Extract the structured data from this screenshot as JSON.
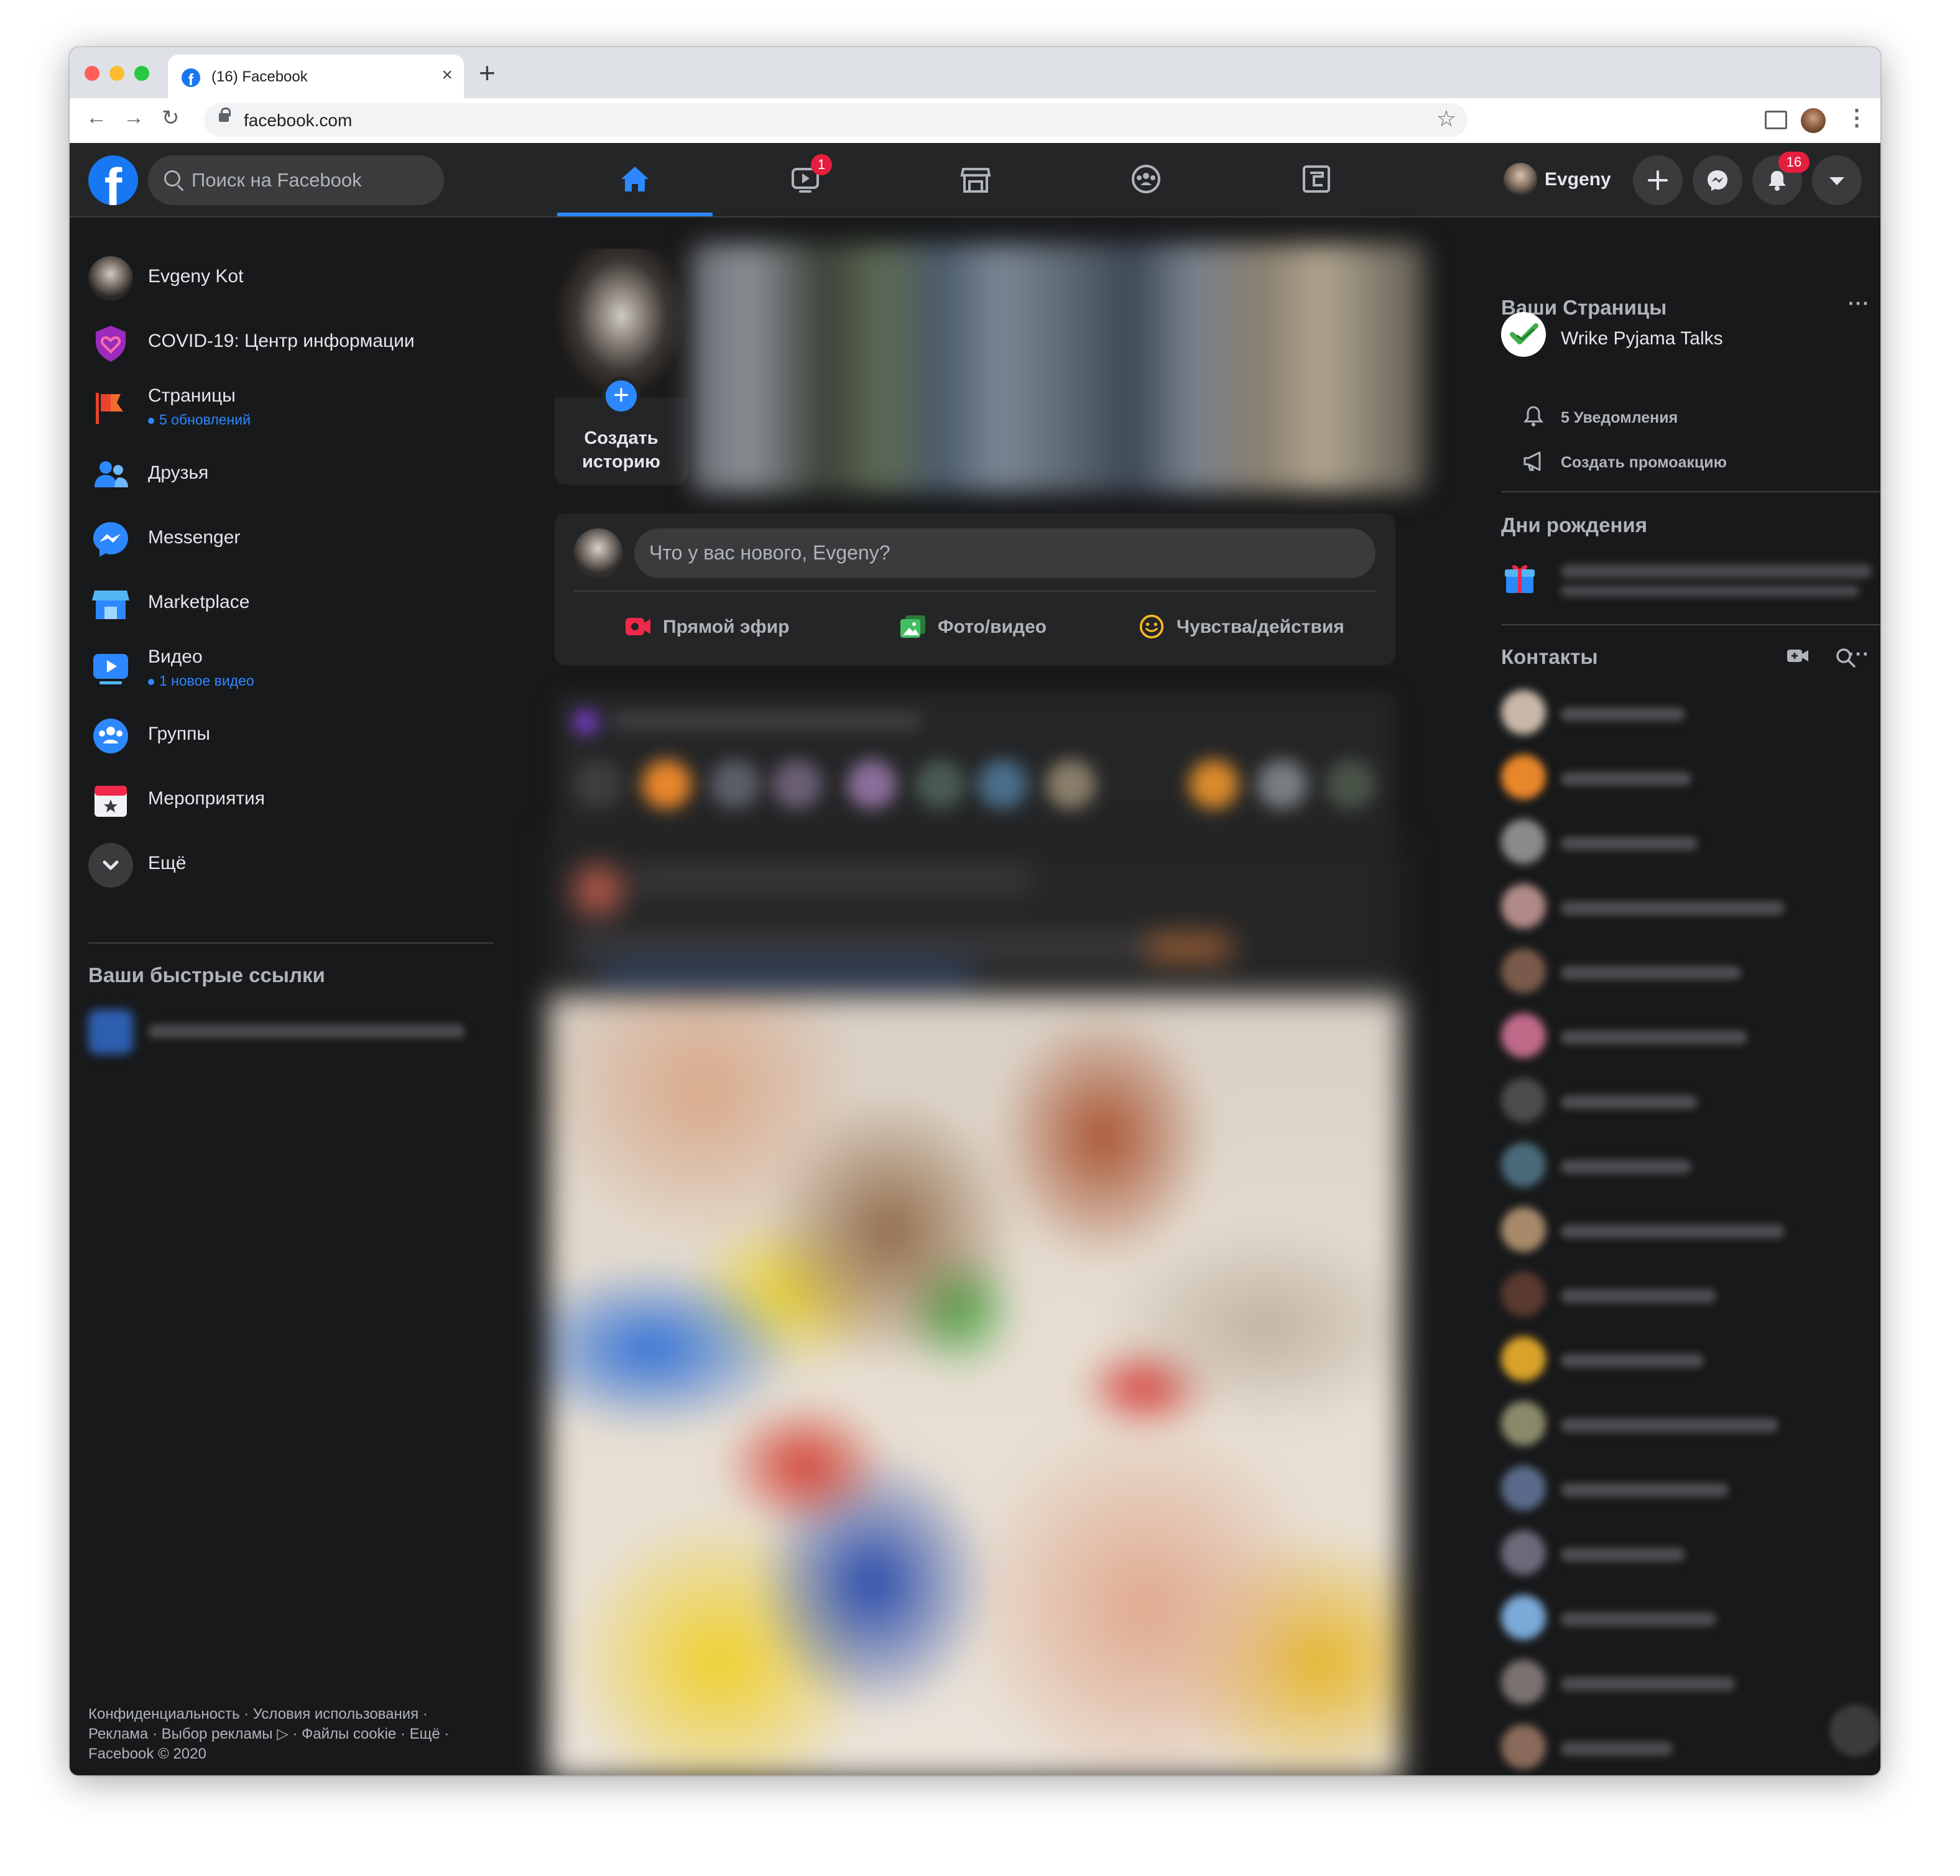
{
  "browser": {
    "tab_title": "(16) Facebook",
    "tab_close": "×",
    "new_tab": "+",
    "url": "facebook.com",
    "back": "←",
    "forward": "→",
    "reload": "↻",
    "bookmark": "☆",
    "menu": "⋮",
    "traffic_light_colors": [
      "#ff5f57",
      "#febc2e",
      "#28c840"
    ]
  },
  "header": {
    "logo": "f",
    "search_placeholder": "Поиск на Facebook",
    "nav_tabs": [
      {
        "name": "home",
        "icon": "home-icon",
        "active": true
      },
      {
        "name": "watch",
        "icon": "video-icon",
        "badge": "1"
      },
      {
        "name": "marketplace",
        "icon": "store-icon"
      },
      {
        "name": "groups",
        "icon": "groups-icon"
      },
      {
        "name": "gaming",
        "icon": "gaming-icon"
      }
    ],
    "user_name": "Evgeny",
    "notifications_badge": "16",
    "accent_color": "#2d88ff",
    "badge_color": "#e41e3f"
  },
  "left_sidebar": {
    "items": [
      {
        "label": "Evgeny Kot",
        "icon": "avatar"
      },
      {
        "label": "COVID-19: Центр информации",
        "icon": "covid-heart-icon"
      },
      {
        "label": "Страницы",
        "sub": "5 обновлений",
        "icon": "pages-flag-icon"
      },
      {
        "label": "Друзья",
        "icon": "friends-icon"
      },
      {
        "label": "Messenger",
        "icon": "messenger-icon"
      },
      {
        "label": "Marketplace",
        "icon": "marketplace-icon"
      },
      {
        "label": "Видео",
        "sub": "1 новое видео",
        "icon": "video-icon"
      },
      {
        "label": "Группы",
        "icon": "groups-icon"
      },
      {
        "label": "Мероприятия",
        "icon": "events-calendar-icon"
      },
      {
        "label": "Ещё",
        "icon": "chevron-down-icon"
      }
    ],
    "shortcuts_title": "Ваши быстрые ссылки",
    "footer_line1": "Конфиденциальность · Условия использования ·",
    "footer_line2": "Реклама · Выбор рекламы ▷ · Файлы cookie · Ещё ·",
    "footer_line3": "Facebook © 2020"
  },
  "center": {
    "create_story": "Создать историю",
    "composer_placeholder": "Что у вас нового, Evgeny?",
    "actions": [
      {
        "label": "Прямой эфир",
        "icon": "live-video-icon",
        "color": "#f02849"
      },
      {
        "label": "Фото/видео",
        "icon": "photo-icon",
        "color": "#45bd62"
      },
      {
        "label": "Чувства/действия",
        "icon": "feeling-smile-icon",
        "color": "#f7b928"
      }
    ]
  },
  "right_sidebar": {
    "pages_title": "Ваши Страницы",
    "page_name": "Wrike Pyjama Talks",
    "page_notifications": "5 Уведомления",
    "page_promo": "Создать промоакцию",
    "birthdays_title": "Дни рождения",
    "contacts_title": "Контакты",
    "more": "···"
  }
}
